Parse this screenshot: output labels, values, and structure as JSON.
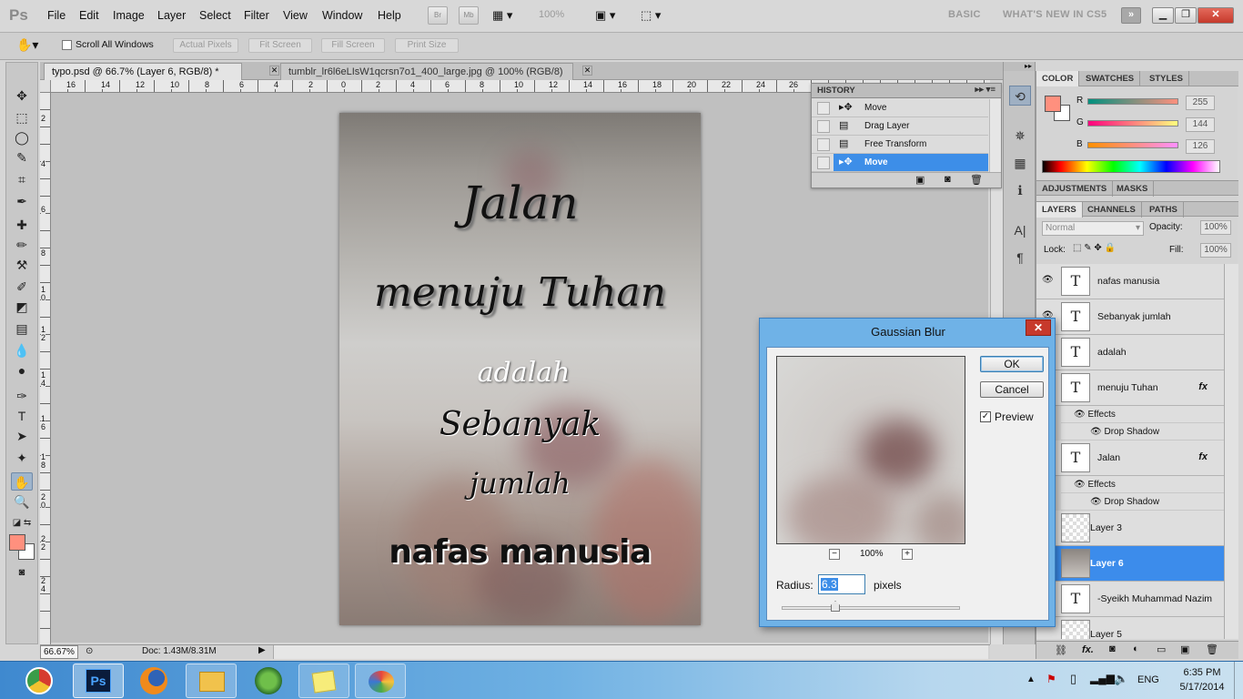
{
  "menubar": {
    "logo": "Ps",
    "items": [
      "File",
      "Edit",
      "Image",
      "Layer",
      "Select",
      "Filter",
      "View",
      "Window",
      "Help"
    ],
    "bridge": "Br",
    "minibridge": "Mb",
    "zoom": "100%",
    "workspace_basic": "BASIC",
    "workspace_new": "WHAT'S NEW IN CS5",
    "more": "»"
  },
  "options": {
    "scroll_all": "Scroll All Windows",
    "actual_pixels": "Actual Pixels",
    "fit_screen": "Fit Screen",
    "fill_screen": "Fill Screen",
    "print_size": "Print Size"
  },
  "tabs": [
    {
      "label": "typo.psd @ 66.7% (Layer 6, RGB/8) *"
    },
    {
      "label": "tumblr_lr6l6eLIsW1qcrsn7o1_400_large.jpg @ 100% (RGB/8)"
    }
  ],
  "ruler": {
    "top": [
      "16",
      "14",
      "12",
      "10",
      "8",
      "6",
      "4",
      "2",
      "0",
      "2",
      "4",
      "6",
      "8",
      "10",
      "12",
      "14",
      "16",
      "18",
      "20",
      "22",
      "24",
      "26"
    ],
    "left": [
      "2",
      "4",
      "6",
      "8",
      "1\n0",
      "1\n2",
      "1\n4",
      "1\n6",
      "1\n8",
      "2\n0",
      "2\n2",
      "2\n4"
    ]
  },
  "document": {
    "line1": "Jalan",
    "line2": "menuju Tuhan",
    "line3": "adalah",
    "line4": "Sebanyak",
    "line5": "jumlah",
    "line6": "nafas manusia"
  },
  "status": {
    "zoom": "66.67%",
    "doc": "Doc: 1.43M/8.31M"
  },
  "history": {
    "title": "HISTORY",
    "items": [
      {
        "label": "Move",
        "icon": "move-icon"
      },
      {
        "label": "Drag Layer",
        "icon": "document-icon"
      },
      {
        "label": "Free Transform",
        "icon": "document-icon"
      },
      {
        "label": "Move",
        "icon": "move-icon",
        "selected": true
      }
    ]
  },
  "color_panel": {
    "tabs": [
      "COLOR",
      "SWATCHES",
      "STYLES"
    ],
    "r_label": "R",
    "g_label": "G",
    "b_label": "B",
    "r": "255",
    "g": "144",
    "b": "126",
    "foreground": "#ff907e"
  },
  "adjustments": {
    "tabs": [
      "ADJUSTMENTS",
      "MASKS"
    ]
  },
  "layers_panel": {
    "tabs": [
      "LAYERS",
      "CHANNELS",
      "PATHS"
    ],
    "blend_mode": "Normal",
    "opacity_label": "Opacity:",
    "opacity": "100%",
    "lock_label": "Lock:",
    "fill_label": "Fill:",
    "fill": "100%",
    "layers": [
      {
        "name": "nafas manusia",
        "type": "T"
      },
      {
        "name": "Sebanyak  jumlah",
        "type": "T"
      },
      {
        "name": "adalah",
        "type": "T"
      },
      {
        "name": "menuju Tuhan",
        "type": "T",
        "fx": "fx"
      },
      {
        "name": "Jalan",
        "type": "T",
        "fx": "fx"
      },
      {
        "name": "Layer 3",
        "type": "image"
      },
      {
        "name": "Layer 6",
        "type": "image",
        "selected": true
      },
      {
        "name": "-Syeikh Muhammad Nazim",
        "type": "T"
      },
      {
        "name": "Layer 5",
        "type": "image"
      }
    ],
    "effects_label": "Effects",
    "drop_shadow_label": "Drop Shadow",
    "footer_fx": "fx."
  },
  "gaussian_blur": {
    "title": "Gaussian Blur",
    "ok": "OK",
    "cancel": "Cancel",
    "preview_label": "Preview",
    "preview_checked": true,
    "zoom_out": "−",
    "zoom": "100%",
    "zoom_in": "+",
    "radius_label": "Radius:",
    "radius": "6.3",
    "units": "pixels"
  },
  "taskbar": {
    "language": "ENG",
    "time": "6:35 PM",
    "date": "5/17/2014",
    "apps": [
      "chrome-icon",
      "photoshop-icon",
      "firefox-icon",
      "explorer-icon",
      "globe-icon",
      "sticky-notes-icon",
      "paint-icon"
    ],
    "ps_label": "Ps"
  }
}
